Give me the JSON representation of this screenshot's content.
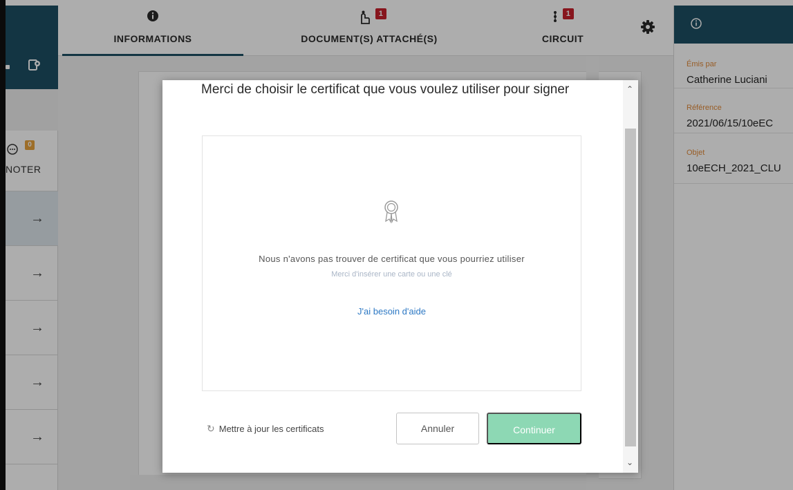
{
  "tabs": [
    {
      "label": "INFORMATIONS",
      "icon": "info-icon"
    },
    {
      "label": "DOCUMENT(S) ATTACHÉ(S)",
      "icon": "attach-hand-icon",
      "badge": "1"
    },
    {
      "label": "CIRCUIT",
      "icon": "circuit-icon",
      "badge": "1"
    }
  ],
  "left_panel": {
    "annoter": {
      "label": "NOTER",
      "badge": "0"
    },
    "arrow_glyph": "→"
  },
  "right_panel": {
    "fields": [
      {
        "label": "Émis par",
        "value": "Catherine Luciani"
      },
      {
        "label": "Référence",
        "value": "2021/06/15/10eEC"
      },
      {
        "label": "Objet",
        "value": "10eECH_2021_CLU"
      }
    ]
  },
  "modal": {
    "title": "Merci de choisir le certificat que vous voulez utiliser pour signer",
    "message": "Nous n'avons pas trouver de certificat que vous pourriez utiliser",
    "submessage": "Merci d'insérer une carte ou une clé",
    "help_link": "J'ai besoin d'aide",
    "refresh_label": "Mettre à jour les certificats",
    "cancel_label": "Annuler",
    "continue_label": "Continuer"
  },
  "colors": {
    "header_teal": "#1d4f63",
    "badge_red": "#c8202b",
    "badge_orange": "#e8a33d",
    "continue_green": "#8dd8b4",
    "link_blue": "#2c78c4",
    "field_label_orange": "#e08a3a"
  }
}
